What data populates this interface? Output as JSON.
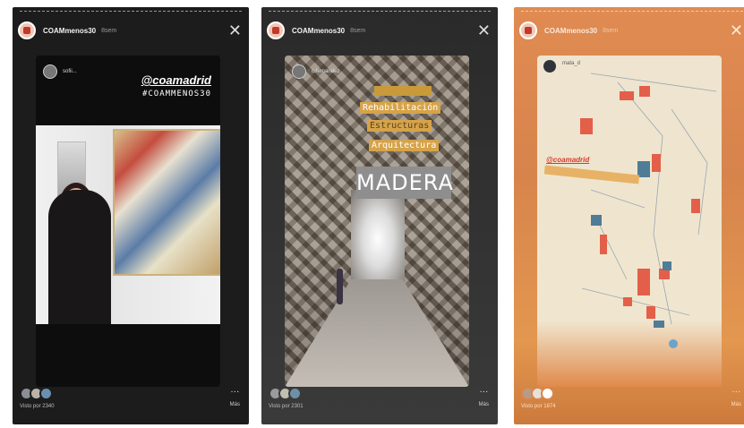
{
  "stories": [
    {
      "user": "COAMmenos30",
      "time": "8sem",
      "card_user": "sofii...",
      "tags": [
        "@coamadrid",
        "#COAMMENOS30"
      ],
      "views": "Visto por 2340",
      "more_label": "Más"
    },
    {
      "user": "COAMmenos30",
      "time": "8sem",
      "card_user": "c.fernandez",
      "labels": [
        "Intervención",
        "Rehabilitación",
        "Estructuras",
        "Arquitectura"
      ],
      "headline": "MADERA",
      "views": "Visto por 2301",
      "more_label": "Más"
    },
    {
      "user": "COAMmenos30",
      "time": "8sem",
      "card_user": "mata_d",
      "tag": "@coamadrid",
      "views": "Visto por 1874",
      "more_label": "Más"
    }
  ],
  "colors": {
    "accent_red": "#d83a2a",
    "label_gold": "#d6a349",
    "card3_orange": "#e08b52"
  },
  "icons": {
    "close": "close-icon",
    "more": "more-dots-icon"
  }
}
